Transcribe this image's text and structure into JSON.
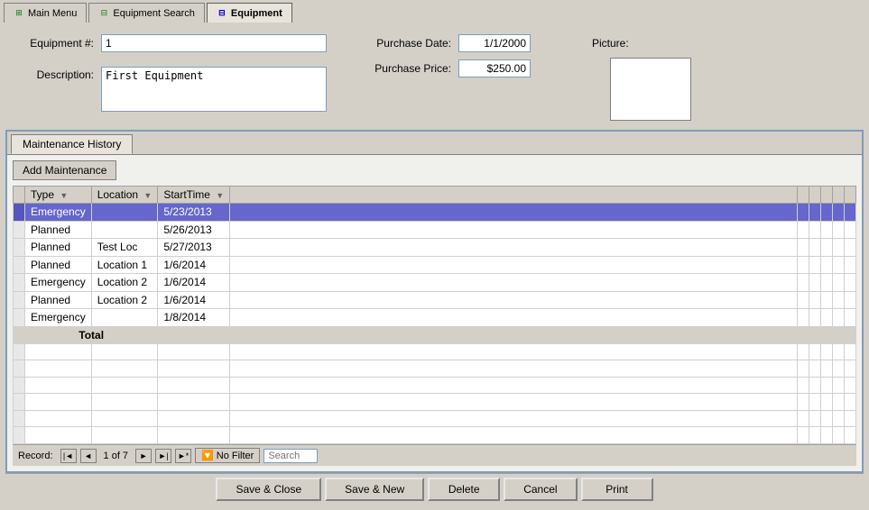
{
  "tabs": [
    {
      "label": "Main Menu",
      "icon": "⊞",
      "iconClass": "green",
      "active": false
    },
    {
      "label": "Equipment Search",
      "icon": "⊟",
      "iconClass": "green",
      "active": false
    },
    {
      "label": "Equipment",
      "icon": "⊟",
      "iconClass": "blue",
      "active": true
    }
  ],
  "form": {
    "equipment_number_label": "Equipment #:",
    "equipment_number_value": "1",
    "description_label": "Description:",
    "description_value": "First Equipment",
    "purchase_date_label": "Purchase Date:",
    "purchase_date_value": "1/1/2000",
    "purchase_price_label": "Purchase Price:",
    "purchase_price_value": "$250.00",
    "picture_label": "Picture:"
  },
  "maintenance": {
    "tab_label": "Maintenance History",
    "add_button_label": "Add Maintenance",
    "columns": [
      {
        "label": "Type",
        "sort": "▼"
      },
      {
        "label": "Location",
        "sort": "▼"
      },
      {
        "label": "StartTime",
        "sort": "▼"
      }
    ],
    "rows": [
      {
        "selected": true,
        "type": "Emergency",
        "location": "",
        "starttime": "5/23/2013"
      },
      {
        "selected": false,
        "type": "Planned",
        "location": "",
        "starttime": "5/26/2013"
      },
      {
        "selected": false,
        "type": "Planned",
        "location": "Test Loc",
        "starttime": "5/27/2013"
      },
      {
        "selected": false,
        "type": "Planned",
        "location": "Location 1",
        "starttime": "1/6/2014"
      },
      {
        "selected": false,
        "type": "Emergency",
        "location": "Location 2",
        "starttime": "1/6/2014"
      },
      {
        "selected": false,
        "type": "Planned",
        "location": "Location 2",
        "starttime": "1/6/2014"
      },
      {
        "selected": false,
        "type": "Emergency",
        "location": "",
        "starttime": "1/8/2014"
      }
    ],
    "total_label": "Total",
    "empty_rows": 6
  },
  "record_nav": {
    "record_label": "Record:",
    "record_info": "1 of 7",
    "no_filter_label": "No Filter",
    "search_placeholder": "Search"
  },
  "buttons": {
    "save_close": "Save & Close",
    "save_new": "Save & New",
    "delete": "Delete",
    "cancel": "Cancel",
    "print": "Print"
  }
}
